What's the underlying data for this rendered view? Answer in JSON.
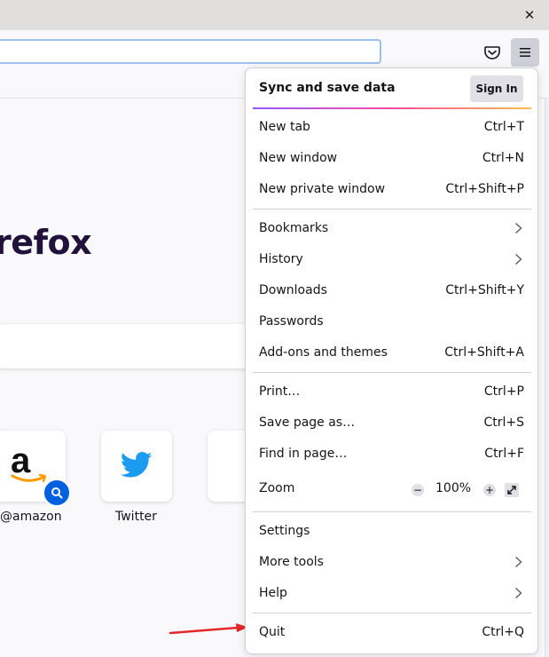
{
  "titlebar": {
    "close_glyph": "✕"
  },
  "icons": {
    "pocket": "pocket-icon",
    "menu": "hamburger-menu-icon",
    "twitter": "twitter-bird-icon",
    "amazon": "amazon-logo-icon",
    "search": "search-icon"
  },
  "newtab": {
    "brand_text": "refox",
    "tiles": [
      {
        "label": "@amazon"
      },
      {
        "label": "Twitter"
      }
    ],
    "amazon_glyph": "a"
  },
  "menu": {
    "sync_title": "Sync and save data",
    "sign_in": "Sign In",
    "items": [
      {
        "label": "New tab",
        "shortcut": "Ctrl+T"
      },
      {
        "label": "New window",
        "shortcut": "Ctrl+N"
      },
      {
        "label": "New private window",
        "shortcut": "Ctrl+Shift+P"
      },
      {
        "label": "Bookmarks",
        "shortcut": ""
      },
      {
        "label": "History",
        "shortcut": ""
      },
      {
        "label": "Downloads",
        "shortcut": "Ctrl+Shift+Y"
      },
      {
        "label": "Passwords",
        "shortcut": ""
      },
      {
        "label": "Add-ons and themes",
        "shortcut": "Ctrl+Shift+A"
      },
      {
        "label": "Print…",
        "shortcut": "Ctrl+P"
      },
      {
        "label": "Save page as…",
        "shortcut": "Ctrl+S"
      },
      {
        "label": "Find in page…",
        "shortcut": "Ctrl+F"
      },
      {
        "label": "Zoom",
        "shortcut": ""
      },
      {
        "label": "Settings",
        "shortcut": ""
      },
      {
        "label": "More tools",
        "shortcut": ""
      },
      {
        "label": "Help",
        "shortcut": ""
      },
      {
        "label": "Quit",
        "shortcut": "Ctrl+Q"
      }
    ],
    "zoom": {
      "minus": "−",
      "value": "100%",
      "plus": "+"
    }
  },
  "colors": {
    "accent": "#0060df",
    "arrow": "#e22828",
    "twitter": "#1d9bf0"
  }
}
